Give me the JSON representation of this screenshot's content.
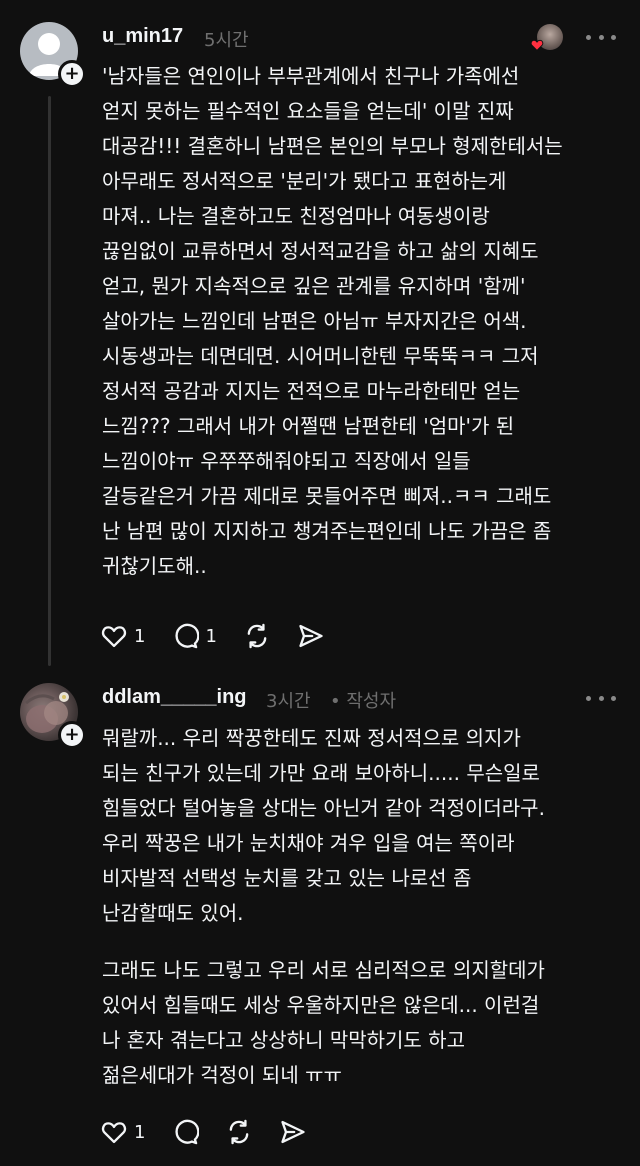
{
  "comments": [
    {
      "username": "u_min17",
      "time": "5시간",
      "lines": [
        "'남자들은 연인이나 부부관계에서 친구나 가족에선",
        "얻지 못하는 필수적인 요소들을 얻는데'  이말 진짜",
        "대공감!!! 결혼하니 남편은 본인의 부모나 형제한테서는",
        "아무래도 정서적으로 '분리'가 됐다고 표현하는게",
        "마져.. 나는 결혼하고도 친정엄마나 여동생이랑",
        "끊임없이 교류하면서 정서적교감을 하고 삶의 지혜도",
        "얻고, 뭔가 지속적으로 깊은 관계를 유지하며 '함께'",
        "살아가는 느낌인데 남편은 아님ㅠ 부자지간은 어색.",
        "시동생과는 데면데면. 시어머니한텐 무뚝뚝ㅋㅋ 그저",
        "정서적 공감과 지지는 전적으로 마누라한테만 얻는",
        "느낌??? 그래서 내가 어쩔땐 남편한테 '엄마'가 된",
        "느낌이야ㅠ 우쭈쭈해줘야되고 직장에서 일들",
        "갈등같은거 가끔 제대로 못들어주면 삐져..ㅋㅋ 그래도",
        "난 남편 많이 지지하고 챙겨주는편인데 나도 가끔은 좀",
        "귀찮기도해.."
      ],
      "likes": "1",
      "replies": "1"
    },
    {
      "username": "ddlam_____ing",
      "time": "3시간",
      "author_tag": "• 작성자",
      "paragraphs": [
        [
          "뭐랄까... 우리 짝꿍한테도 진짜 정서적으로 의지가",
          "되는 친구가 있는데 가만 요래 보아하니..... 무슨일로",
          "힘들었다 털어놓을 상대는 아닌거 같아 걱정이더라구.",
          "우리 짝꿍은 내가 눈치채야 겨우 입을 여는 쪽이라",
          "비자발적 선택성 눈치를 갖고 있는 나로선 좀",
          "난감할때도 있어."
        ],
        [
          "그래도 나도 그렇고 우리 서로 심리적으로 의지할데가",
          "있어서 힘들때도 세상 우울하지만은 않은데... 이런걸",
          "나 혼자 겪는다고 상상하니 막막하기도 하고",
          "젊은세대가 걱정이 되네 ㅠㅠ"
        ]
      ],
      "likes": "1"
    }
  ]
}
